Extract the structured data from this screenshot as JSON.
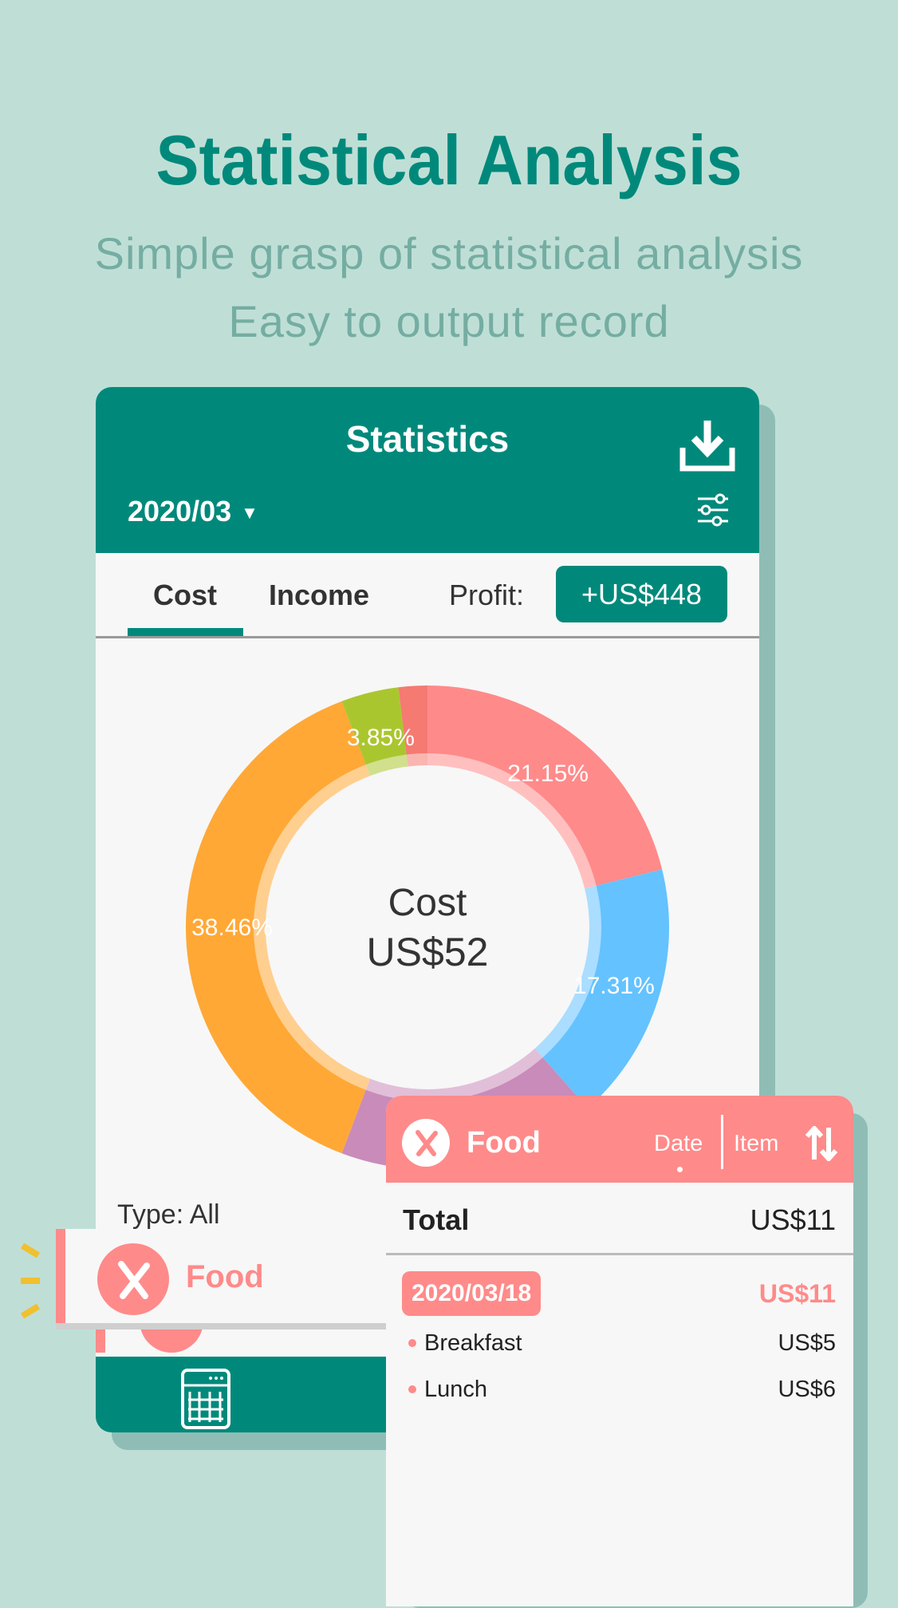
{
  "promo": {
    "title": "Statistical Analysis",
    "subtitle_line1": "Simple grasp of statistical analysis",
    "subtitle_line2": "Easy to output record"
  },
  "colors": {
    "background": "#BFDFD6",
    "primary": "#00897B",
    "accent": "#FF8A8A"
  },
  "statistics": {
    "title": "Statistics",
    "month": "2020/03",
    "download_icon": "download-icon",
    "filter_icon": "sliders-icon",
    "tabs": [
      {
        "label": "Cost",
        "active": true
      },
      {
        "label": "Income",
        "active": false
      }
    ],
    "profit_label": "Profit:",
    "profit_value": "+US$448",
    "center_label": "Cost",
    "center_value": "US$52",
    "type_label": "Type: All",
    "selected_category": "Food",
    "bottom_nav_icon": "calculator-icon"
  },
  "chart_data": {
    "type": "pie",
    "donut": true,
    "start": "12 o'clock",
    "direction": "clockwise",
    "slices": [
      {
        "value": 21.15,
        "label": "21.15%",
        "color": "#FF8A8A"
      },
      {
        "value": 17.31,
        "label": "17.31%",
        "color": "#64C2FF"
      },
      {
        "value": 17.31,
        "label": "",
        "color": "#C98BB9"
      },
      {
        "value": 38.46,
        "label": "38.46%",
        "color": "#FFA836"
      },
      {
        "value": 3.85,
        "label": "3.85%",
        "color": "#AAC62F"
      },
      {
        "value": 1.92,
        "label": "",
        "color": "#F47A72"
      }
    ]
  },
  "detail": {
    "category": "Food",
    "sort_date": "Date",
    "sort_item": "Item",
    "total_label": "Total",
    "total_value": "US$11",
    "groups": [
      {
        "date": "2020/03/18",
        "amount": "US$11",
        "items": [
          {
            "name": "Breakfast",
            "amount": "US$5"
          },
          {
            "name": "Lunch",
            "amount": "US$6"
          }
        ]
      }
    ]
  }
}
